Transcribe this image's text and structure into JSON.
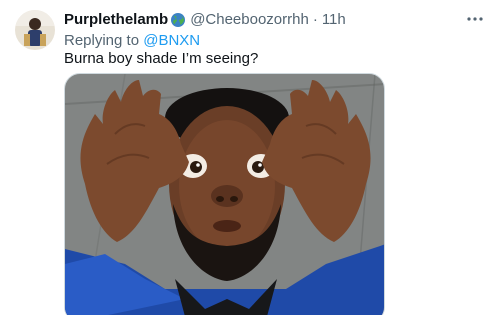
{
  "tweet": {
    "display_name": "Purplethelamb",
    "badge_icon": "globe-emoji-icon",
    "handle": "@Cheeboozorrhh",
    "separator": "·",
    "time": "11h",
    "reply_prefix": "Replying to",
    "reply_to": "@BNXN",
    "text": "Burna boy shade I’m seeing?"
  },
  "icons": {
    "avatar": "avatar",
    "more": "more-options-icon",
    "media": "meme-photo"
  },
  "colors": {
    "text_primary": "#0f1419",
    "text_secondary": "#536471",
    "link": "#1d9bf0",
    "background": "#ffffff"
  }
}
